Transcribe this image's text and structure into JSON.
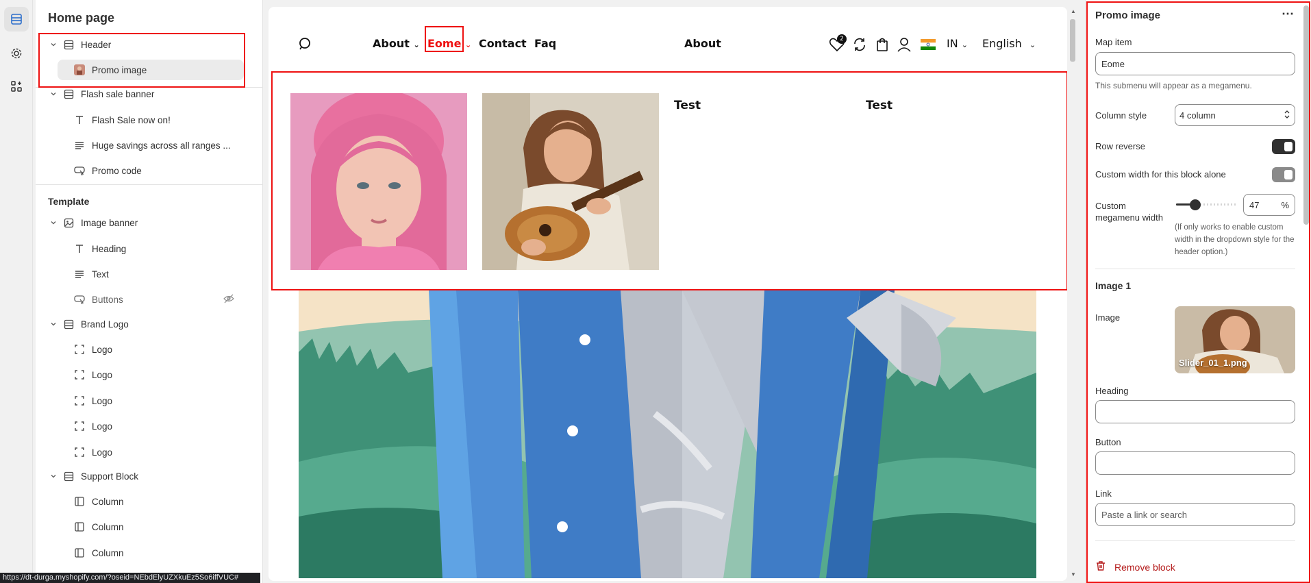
{
  "sidebar": {
    "title": "Home page",
    "header_group": [
      {
        "label": "Header",
        "icon": "section-icon"
      },
      {
        "label": "Promo image",
        "icon": "image-thumb-icon"
      }
    ],
    "flash_group": [
      {
        "label": "Flash sale banner",
        "icon": "section-icon"
      },
      {
        "label": "Flash Sale now on!",
        "icon": "text-icon"
      },
      {
        "label": "Huge savings across all ranges ...",
        "icon": "paragraph-icon"
      },
      {
        "label": "Promo code",
        "icon": "promo-icon"
      }
    ],
    "template_label": "Template",
    "template_items": [
      {
        "label": "Image banner",
        "icon": "image-icon"
      },
      {
        "label": "Heading",
        "icon": "text-icon"
      },
      {
        "label": "Text",
        "icon": "paragraph-icon"
      },
      {
        "label": "Buttons",
        "icon": "promo-icon"
      },
      {
        "label": "Brand Logo",
        "icon": "section-icon"
      },
      {
        "label": "Logo",
        "icon": "frame-icon"
      },
      {
        "label": "Logo",
        "icon": "frame-icon"
      },
      {
        "label": "Logo",
        "icon": "frame-icon"
      },
      {
        "label": "Logo",
        "icon": "frame-icon"
      },
      {
        "label": "Logo",
        "icon": "frame-icon"
      },
      {
        "label": "Support Block",
        "icon": "section-icon"
      },
      {
        "label": "Column",
        "icon": "column-icon"
      },
      {
        "label": "Column",
        "icon": "column-icon"
      },
      {
        "label": "Column",
        "icon": "column-icon"
      }
    ]
  },
  "status_url": "https://dt-durga.myshopify.com/?oseid=NEbdElyUZXkuEz5So6iffVUC#",
  "preview": {
    "nav": {
      "links": [
        "About",
        "Eome",
        "Contact",
        "Faq"
      ],
      "center_link": "About",
      "cart_count": "2",
      "country": "IN",
      "language": "English"
    },
    "mega": {
      "col3_title": "Test",
      "col4_title": "Test"
    }
  },
  "settings": {
    "title": "Promo image",
    "map_item_label": "Map item",
    "map_item_value": "Eome",
    "map_item_help": "This submenu will appear as a megamenu.",
    "column_style_label": "Column style",
    "column_style_value": "4 column",
    "row_reverse_label": "Row reverse",
    "row_reverse_on": true,
    "custom_width_label": "Custom width for this block alone",
    "custom_width_on": false,
    "megamenu_width_label": "Custom megamenu width",
    "megamenu_width_value": "47",
    "megamenu_width_unit": "%",
    "megamenu_width_help": "(If only works to enable custom width in the dropdown style for the header option.)",
    "image1_heading": "Image 1",
    "image_label": "Image",
    "image_filename": "Slider_01_1.png",
    "heading_label": "Heading",
    "heading_value": "",
    "button_label": "Button",
    "button_value": "",
    "link_label": "Link",
    "link_placeholder": "Paste a link or search",
    "remove_label": "Remove block"
  },
  "colors": {
    "highlight_red": "#e11111",
    "toggle_on": "#303030",
    "remove_red": "#b51c1c"
  }
}
